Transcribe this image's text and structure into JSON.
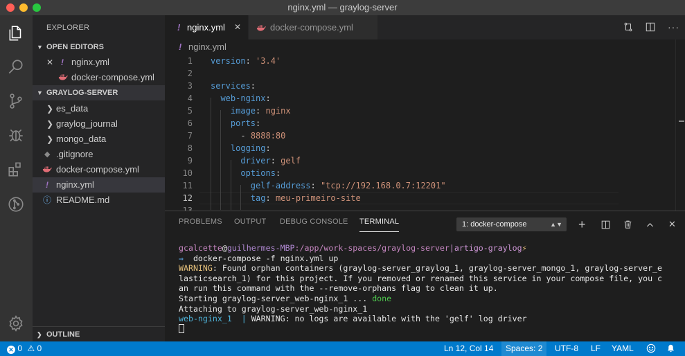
{
  "window": {
    "title": "nginx.yml — graylog-server"
  },
  "sidebar": {
    "title": "EXPLORER",
    "open_editors": {
      "label": "OPEN EDITORS",
      "items": [
        {
          "close": "✕",
          "icon": "!",
          "label": "nginx.yml"
        },
        {
          "icon": "docker-icon",
          "label": "docker-compose.yml"
        }
      ]
    },
    "project": {
      "label": "GRAYLOG-SERVER",
      "items": [
        {
          "type": "folder",
          "label": "es_data"
        },
        {
          "type": "folder",
          "label": "graylog_journal"
        },
        {
          "type": "folder",
          "label": "mongo_data"
        },
        {
          "type": "file",
          "icon": "git-icon",
          "label": ".gitignore"
        },
        {
          "type": "file",
          "icon": "docker-icon",
          "label": "docker-compose.yml"
        },
        {
          "type": "file",
          "icon": "yml-icon",
          "label": "nginx.yml",
          "selected": true
        },
        {
          "type": "file",
          "icon": "info-icon",
          "label": "README.md"
        }
      ]
    },
    "outline": {
      "label": "OUTLINE"
    }
  },
  "tabs": [
    {
      "label": "nginx.yml",
      "active": true,
      "icon": "!",
      "close": "✕"
    },
    {
      "label": "docker-compose.yml",
      "active": false,
      "icon": "docker-icon"
    }
  ],
  "editor": {
    "breadcrumb": "nginx.yml",
    "breadcrumb_icon": "!",
    "line_numbers": [
      "1",
      "2",
      "3",
      "4",
      "5",
      "6",
      "7",
      "8",
      "9",
      "10",
      "11",
      "12",
      "13"
    ],
    "current_line": "12",
    "lines": [
      {
        "key": "version",
        "sep": ": ",
        "value": "'3.4'"
      },
      {},
      {
        "key": "services",
        "sep": ":"
      },
      {
        "indent": "  ",
        "key": "web-nginx",
        "sep": ":"
      },
      {
        "indent": "    ",
        "key": "image",
        "sep": ": ",
        "value": "nginx"
      },
      {
        "indent": "    ",
        "key": "ports",
        "sep": ":"
      },
      {
        "indent": "      ",
        "dash": "- ",
        "value": "8888:80"
      },
      {
        "indent": "    ",
        "key": "logging",
        "sep": ":"
      },
      {
        "indent": "      ",
        "key": "driver",
        "sep": ": ",
        "value": "gelf"
      },
      {
        "indent": "      ",
        "key": "options",
        "sep": ":"
      },
      {
        "indent": "        ",
        "key": "gelf-address",
        "sep": ": ",
        "value": "\"tcp://192.168.0.7:12201\""
      },
      {
        "indent": "        ",
        "key": "tag",
        "sep": ": ",
        "value": "meu-primeiro-site"
      },
      {}
    ]
  },
  "panel": {
    "tabs": [
      "PROBLEMS",
      "OUTPUT",
      "DEBUG CONSOLE",
      "TERMINAL"
    ],
    "active_tab": "TERMINAL",
    "terminal_select": "1: docker-compose",
    "terminal": {
      "prompt_user": "gcalcette",
      "prompt_at": "@",
      "prompt_host": "guilhermes-MBP",
      "prompt_path": ":/app/work-spaces/graylog-server",
      "prompt_sep": "|",
      "prompt_branch": "artigo-graylog",
      "prompt_bolt": "⚡",
      "arrow": "⇒",
      "command": "  docker-compose -f nginx.yml up",
      "warning_label": "WARNING",
      "warning_lines": [
        ": Found orphan containers (graylog-server_graylog_1, graylog-server_mongo_1, graylog-server_e",
        "lasticsearch_1) for this project. If you removed or renamed this service in your compose file, you c",
        "an run this command with the --remove-orphans flag to clean it up."
      ],
      "starting": "Starting graylog-server_web-nginx_1 ... ",
      "done": "done",
      "attaching": "Attaching to graylog-server_web-nginx_1",
      "log_service": "web-nginx_1  | ",
      "log_message": "WARNING: no logs are available with the 'gelf' log driver"
    }
  },
  "statusbar": {
    "errors": "0",
    "warnings": "0",
    "position": "Ln 12, Col 14",
    "spaces": "Spaces: 2",
    "encoding": "UTF-8",
    "eol": "LF",
    "language": "YAML"
  },
  "colors": {
    "status_bar": "#007acc",
    "activity_bar": "#333333",
    "sidebar": "#252526",
    "editor": "#1e1e1e"
  }
}
